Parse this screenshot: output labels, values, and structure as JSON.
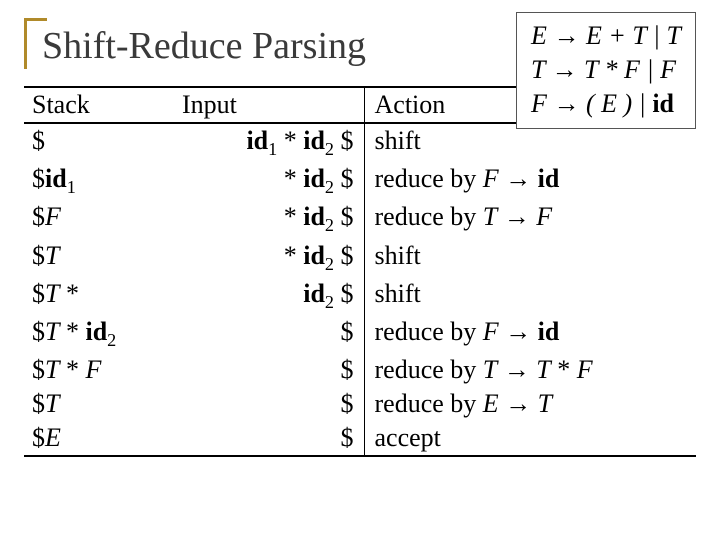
{
  "title": "Shift-Reduce Parsing",
  "grammar": {
    "line1_html": "<span class='nt'>E</span> → <span class='nt'>E</span> + <span class='nt'>T</span> | <span class='nt'>T</span>",
    "line2_html": "<span class='nt'>T</span> → <span class='nt'>T</span> * <span class='nt'>F</span> | <span class='nt'>F</span>",
    "line3_html": "<span class='nt'>F</span> → ( <span class='nt'>E</span> ) | <span class='term'>id</span>"
  },
  "headers": {
    "stack": "Stack",
    "input": "Input",
    "action": "Action"
  },
  "rows": [
    {
      "stack_html": "$",
      "input_html": "<span class='bold'>id</span><sub>1</sub> * <span class='bold'>id</span><sub>2</sub> $",
      "action_html": "shift"
    },
    {
      "stack_html": "$<span class='bold'>id</span><sub>1</sub>",
      "input_html": "* <span class='bold'>id</span><sub>2</sub> $",
      "action_html": "reduce by <span class='tok'>F</span> <span class='arrow'>→</span> <span class='bold'>id</span>"
    },
    {
      "stack_html": "$<span class='tok'>F</span>",
      "input_html": "* <span class='bold'>id</span><sub>2</sub> $",
      "action_html": "reduce by <span class='tok'>T</span> <span class='arrow'>→</span> <span class='tok'>F</span>"
    },
    {
      "stack_html": "$<span class='tok'>T</span>",
      "input_html": "* <span class='bold'>id</span><sub>2</sub> $",
      "action_html": "shift"
    },
    {
      "stack_html": "$<span class='tok'>T</span> *",
      "input_html": "<span class='bold'>id</span><sub>2</sub> $",
      "action_html": "shift"
    },
    {
      "stack_html": "$<span class='tok'>T</span> * <span class='bold'>id</span><sub>2</sub>",
      "input_html": "$",
      "action_html": "reduce by <span class='tok'>F</span> <span class='arrow'>→</span> <span class='bold'>id</span>"
    },
    {
      "stack_html": "$<span class='tok'>T</span> * <span class='tok'>F</span>",
      "input_html": "$",
      "action_html": "reduce by <span class='tok'>T</span> <span class='arrow'>→</span> <span class='tok'>T</span> * <span class='tok'>F</span>"
    },
    {
      "stack_html": "$<span class='tok'>T</span>",
      "input_html": "$",
      "action_html": "reduce by <span class='tok'>E</span> <span class='arrow'>→</span> <span class='tok'>T</span>"
    },
    {
      "stack_html": "$<span class='tok'>E</span>",
      "input_html": "$",
      "action_html": "accept"
    }
  ],
  "chart_data": {
    "type": "table",
    "title": "Shift-Reduce Parsing",
    "grammar": [
      "E → E + T | T",
      "T → T * F | F",
      "F → ( E ) | id"
    ],
    "columns": [
      "Stack",
      "Input",
      "Action"
    ],
    "rows": [
      [
        "$",
        "id1 * id2 $",
        "shift"
      ],
      [
        "$id1",
        "* id2 $",
        "reduce by F → id"
      ],
      [
        "$F",
        "* id2 $",
        "reduce by T → F"
      ],
      [
        "$T",
        "* id2 $",
        "shift"
      ],
      [
        "$T *",
        "id2 $",
        "shift"
      ],
      [
        "$T * id2",
        "$",
        "reduce by F → id"
      ],
      [
        "$T * F",
        "$",
        "reduce by T → T * F"
      ],
      [
        "$T",
        "$",
        "reduce by E → T"
      ],
      [
        "$E",
        "$",
        "accept"
      ]
    ]
  }
}
